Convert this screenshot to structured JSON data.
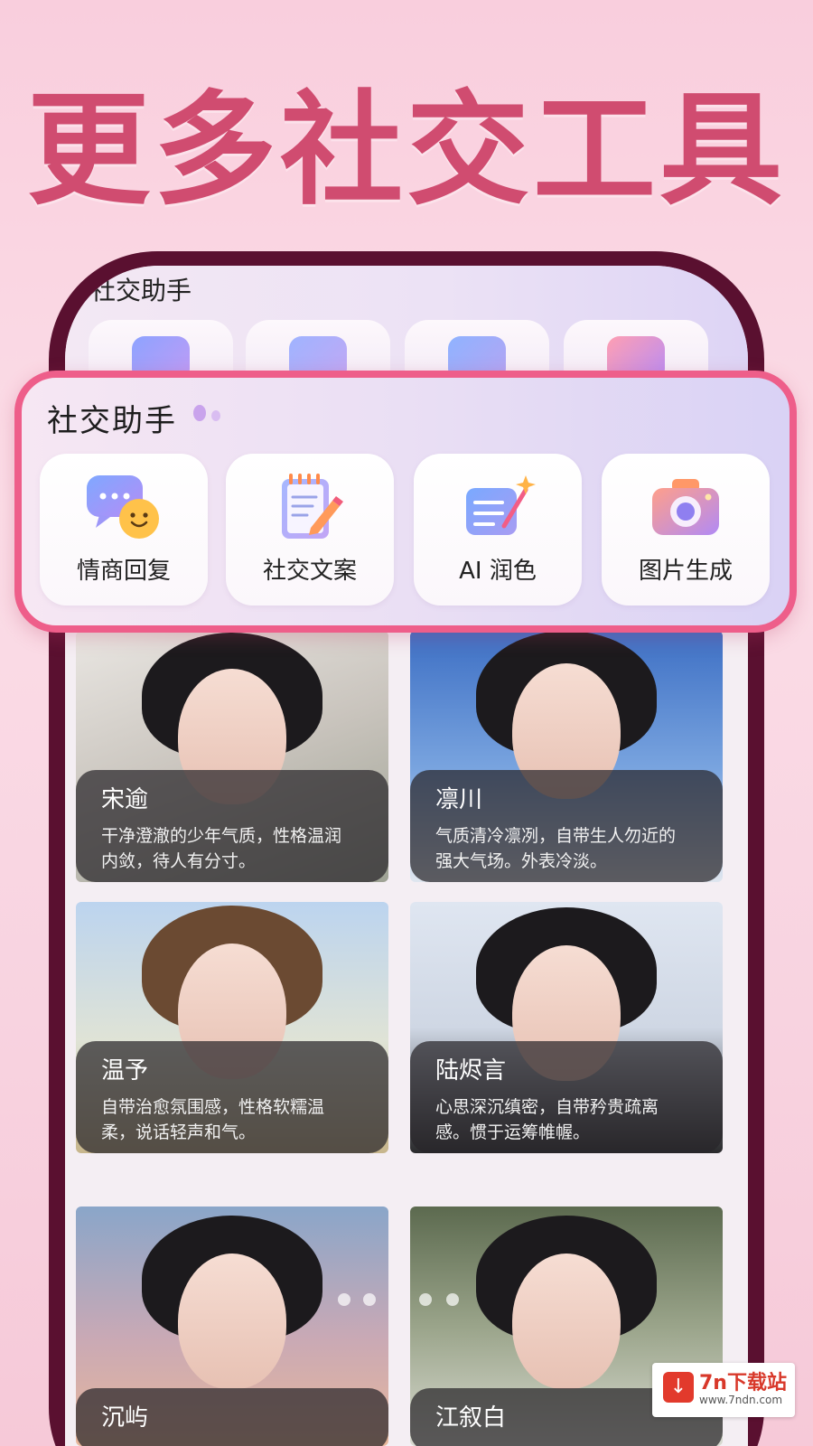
{
  "headline": "更多社交工具",
  "screen": {
    "section_title": "社交助手"
  },
  "panel": {
    "title": "社交助手",
    "tools": [
      {
        "label": "情商回复",
        "icon": "chat-bubble-smile-icon"
      },
      {
        "label": "社交文案",
        "icon": "notepad-pencil-icon"
      },
      {
        "label": "AI 润色",
        "icon": "document-magic-wand-icon"
      },
      {
        "label": "图片生成",
        "icon": "camera-icon"
      }
    ]
  },
  "characters": [
    {
      "name": "宋逾",
      "desc_line1": "干净澄澈的少年气质，性格温润",
      "desc_line2": "内敛，待人有分寸。"
    },
    {
      "name": "凛川",
      "desc_line1": "气质清冷凛冽，自带生人勿近的",
      "desc_line2": "强大气场。外表冷淡。"
    },
    {
      "name": "温予",
      "desc_line1": "自带治愈氛围感，性格软糯温",
      "desc_line2": "柔，说话轻声和气。"
    },
    {
      "name": "陆烬言",
      "desc_line1": "心思深沉缜密，自带矜贵疏离",
      "desc_line2": "感。惯于运筹帷幄。"
    },
    {
      "name": "沉屿",
      "desc_line1": "",
      "desc_line2": ""
    },
    {
      "name": "江叙白",
      "desc_line1": "",
      "desc_line2": ""
    }
  ],
  "watermark": {
    "main": "7n下载站",
    "sub": "www.7ndn.com"
  },
  "colors": {
    "headline": "#d04c70",
    "panel_border": "#ee5e8a",
    "phone_frame": "#5a1030"
  }
}
